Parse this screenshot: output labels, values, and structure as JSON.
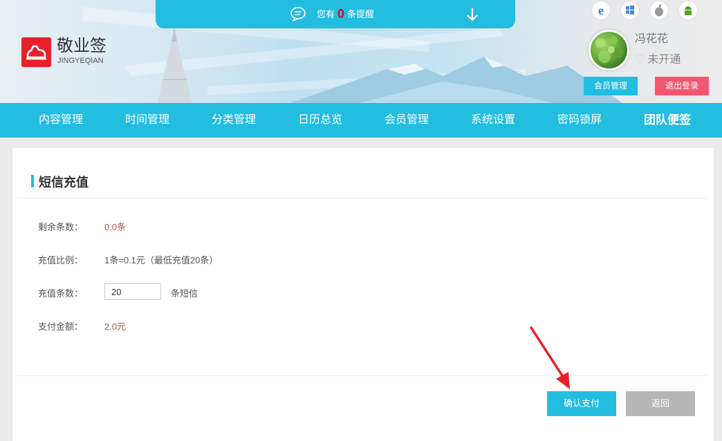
{
  "header": {
    "notice_prefix": "您有",
    "notice_count": "0",
    "notice_suffix": "条提醒",
    "brand_name": "敬业签",
    "brand_sub": "JINGYEQIAN",
    "os_icons": [
      "ie-icon",
      "windows-icon",
      "apple-icon",
      "android-icon"
    ],
    "username": "冯花花",
    "vip_status": "未开通",
    "member_button": "会员管理",
    "logout_button": "退出登录"
  },
  "nav": {
    "items": [
      "内容管理",
      "时间管理",
      "分类管理",
      "日历总览",
      "会员管理",
      "系统设置",
      "密码锁屏",
      "团队便签"
    ]
  },
  "content": {
    "title": "短信充值",
    "remaining_label": "剩余条数：",
    "remaining_value": "0.0条",
    "ratio_label": "充值比例：",
    "ratio_value": "1条=0.1元（最低充值20条）",
    "qty_label": "充值条数：",
    "qty_value": "20",
    "qty_unit": "条短信",
    "amount_label": "支付金额：",
    "amount_value": "2.0元",
    "confirm_button": "确认支付",
    "back_button": "返回"
  },
  "colors": {
    "accent": "#23bde0",
    "logout": "#f2576f",
    "logo": "#e8202b",
    "pointer": "#e8202b"
  }
}
